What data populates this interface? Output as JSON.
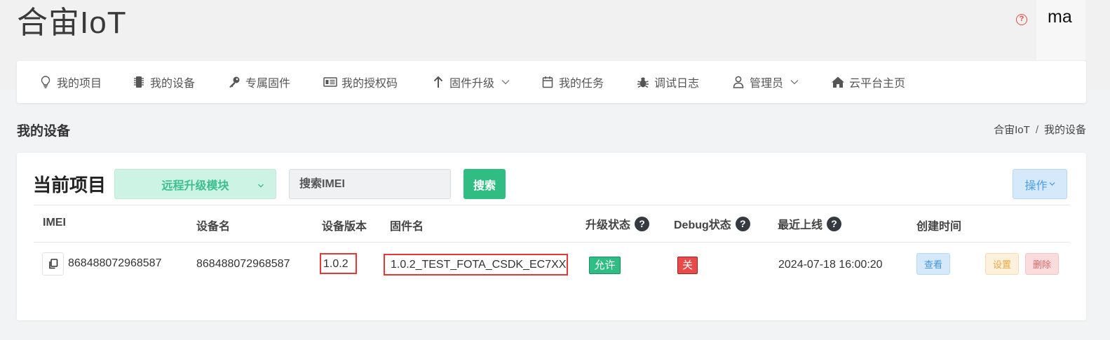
{
  "header": {
    "brand": "合宙IoT",
    "help_icon": "question-circle-icon",
    "user": "ma"
  },
  "nav": {
    "items": [
      {
        "label": "我的项目",
        "icon": "lightbulb-icon"
      },
      {
        "label": "我的设备",
        "icon": "chip-icon"
      },
      {
        "label": "专属固件",
        "icon": "key-icon"
      },
      {
        "label": "我的授权码",
        "icon": "id-card-icon"
      },
      {
        "label": "固件升级",
        "icon": "arrow-up-icon",
        "dropdown": true
      },
      {
        "label": "我的任务",
        "icon": "calendar-icon"
      },
      {
        "label": "调试日志",
        "icon": "bug-icon"
      },
      {
        "label": "管理员",
        "icon": "user-icon",
        "dropdown": true
      },
      {
        "label": "云平台主页",
        "icon": "home-icon"
      }
    ]
  },
  "page": {
    "title": "我的设备",
    "breadcrumb": [
      "合宙IoT",
      "我的设备"
    ]
  },
  "toolbar": {
    "project_label": "当前项目",
    "project_selected": "远程升级模块",
    "search_placeholder": "搜索IMEI",
    "search_button": "搜索",
    "ops_button": "操作"
  },
  "table": {
    "headers": {
      "imei": "IMEI",
      "device_name": "设备名",
      "device_version": "设备版本",
      "firmware_name": "固件名",
      "upgrade_status": "升级状态",
      "debug_status": "Debug状态",
      "last_online": "最近上线",
      "created_time": "创建时间"
    },
    "rows": [
      {
        "imei": "868488072968587",
        "device_name": "868488072968587",
        "device_version": "1.0.2",
        "firmware_name": "1.0.2_TEST_FOTA_CSDK_EC7XX",
        "upgrade_status": "允许",
        "debug_status": "关",
        "last_online": "2024-07-18 16:00:20",
        "view_button": "查看",
        "settings_button": "设置",
        "delete_button": "删除"
      }
    ]
  },
  "colors": {
    "primary_green": "#2fbd83",
    "danger_red": "#e84c4a",
    "highlight_box": "#e53935",
    "info_blue": "#3f95df",
    "warning_orange": "#f0a63d"
  }
}
